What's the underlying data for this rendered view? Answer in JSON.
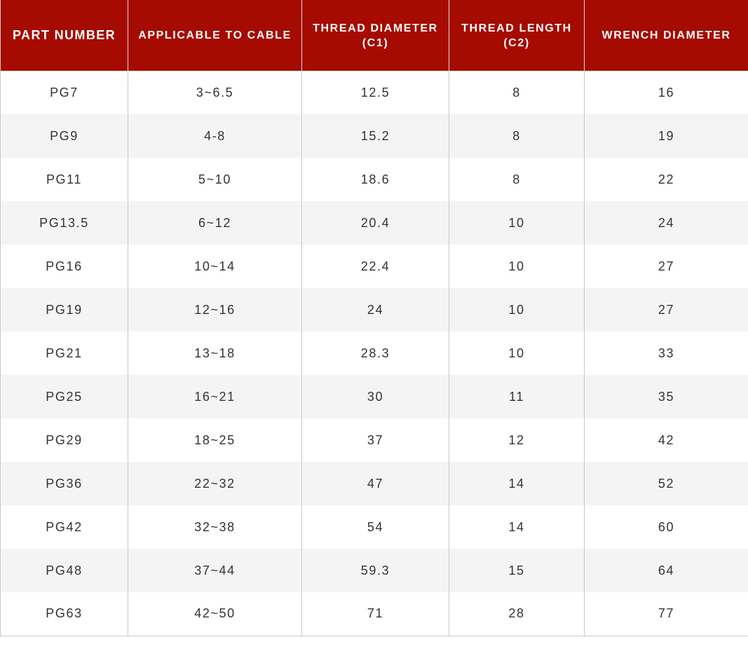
{
  "table": {
    "headers": [
      {
        "line1": "PART NUMBER",
        "line2": ""
      },
      {
        "line1": "APPLICABLE TO CABLE",
        "line2": ""
      },
      {
        "line1": "THREAD DIAMETER",
        "line2": "(C1)"
      },
      {
        "line1": "THREAD LENGTH",
        "line2": "(C2)"
      },
      {
        "line1": "WRENCH DIAMETER",
        "line2": ""
      }
    ],
    "rows": [
      [
        "PG7",
        "3~6.5",
        "12.5",
        "8",
        "16"
      ],
      [
        "PG9",
        "4-8",
        "15.2",
        "8",
        "19"
      ],
      [
        "PG11",
        "5~10",
        "18.6",
        "8",
        "22"
      ],
      [
        "PG13.5",
        "6~12",
        "20.4",
        "10",
        "24"
      ],
      [
        "PG16",
        "10~14",
        "22.4",
        "10",
        "27"
      ],
      [
        "PG19",
        "12~16",
        "24",
        "10",
        "27"
      ],
      [
        "PG21",
        "13~18",
        "28.3",
        "10",
        "33"
      ],
      [
        "PG25",
        "16~21",
        "30",
        "11",
        "35"
      ],
      [
        "PG29",
        "18~25",
        "37",
        "12",
        "42"
      ],
      [
        "PG36",
        "22~32",
        "47",
        "14",
        "52"
      ],
      [
        "PG42",
        "32~38",
        "54",
        "14",
        "60"
      ],
      [
        "PG48",
        "37~44",
        "59.3",
        "15",
        "64"
      ],
      [
        "PG63",
        "42~50",
        "71",
        "28",
        "77"
      ]
    ]
  },
  "colors": {
    "header_background": "#a50b00",
    "header_text": "#ffffff",
    "row_alt_background": "#f4f4f4",
    "cell_text": "#333333"
  }
}
